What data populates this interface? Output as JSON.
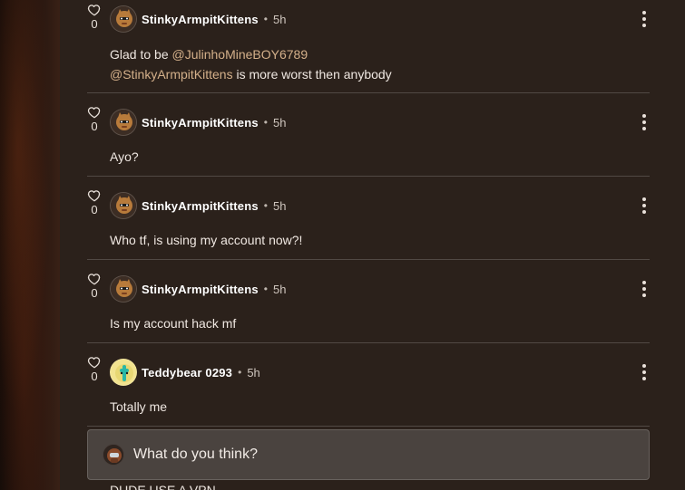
{
  "comments": [
    {
      "username": "StinkyArmpitKittens",
      "time": "5h",
      "likes": "0",
      "lines": [
        {
          "prefix": "Glad to be ",
          "mention": "@JulinhoMineBOY6789",
          "suffix": ""
        },
        {
          "prefix": "",
          "mention": "@StinkyArmpitKittens",
          "suffix": " is more worst then anybody"
        }
      ]
    },
    {
      "username": "StinkyArmpitKittens",
      "time": "5h",
      "likes": "0",
      "text": "Ayo?"
    },
    {
      "username": "StinkyArmpitKittens",
      "time": "5h",
      "likes": "0",
      "text": "Who tf, is using my account now?!"
    },
    {
      "username": "StinkyArmpitKittens",
      "time": "5h",
      "likes": "0",
      "text": "Is my account hack mf"
    },
    {
      "username": "Teddybear 0293",
      "time": "5h",
      "likes": "0",
      "text": "Totally me"
    }
  ],
  "composer": {
    "placeholder": "What do you think?"
  },
  "peek": {
    "text": "DUDE USE A VPN"
  },
  "icons": {
    "like": "heart-icon",
    "more": "more-vertical-icon"
  },
  "colors": {
    "background": "#2b211b",
    "mention": "#d4b08a",
    "composer_bg": "#4a433f"
  }
}
